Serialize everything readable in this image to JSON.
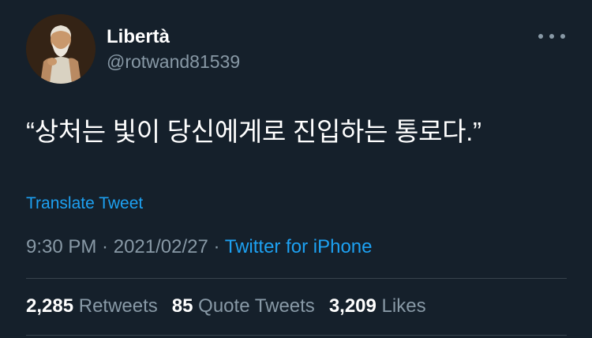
{
  "author": {
    "display_name": "Libertà",
    "handle": "@rotwand81539"
  },
  "tweet": {
    "text": "“상처는 빛이 당신에게로 진입하는 통로다.”",
    "translate_label": "Translate Tweet",
    "time": "9:30 PM",
    "separator": " · ",
    "date": "2021/02/27",
    "source": "Twitter for iPhone"
  },
  "stats": {
    "retweets_count": "2,285",
    "retweets_label": "Retweets",
    "quotes_count": "85",
    "quotes_label": "Quote Tweets",
    "likes_count": "3,209",
    "likes_label": "Likes"
  },
  "icons": {
    "more": "more-horizontal-icon"
  },
  "colors": {
    "background": "#15202b",
    "secondary_text": "#8899a6",
    "accent": "#1da1f2",
    "divider": "#38444d"
  }
}
